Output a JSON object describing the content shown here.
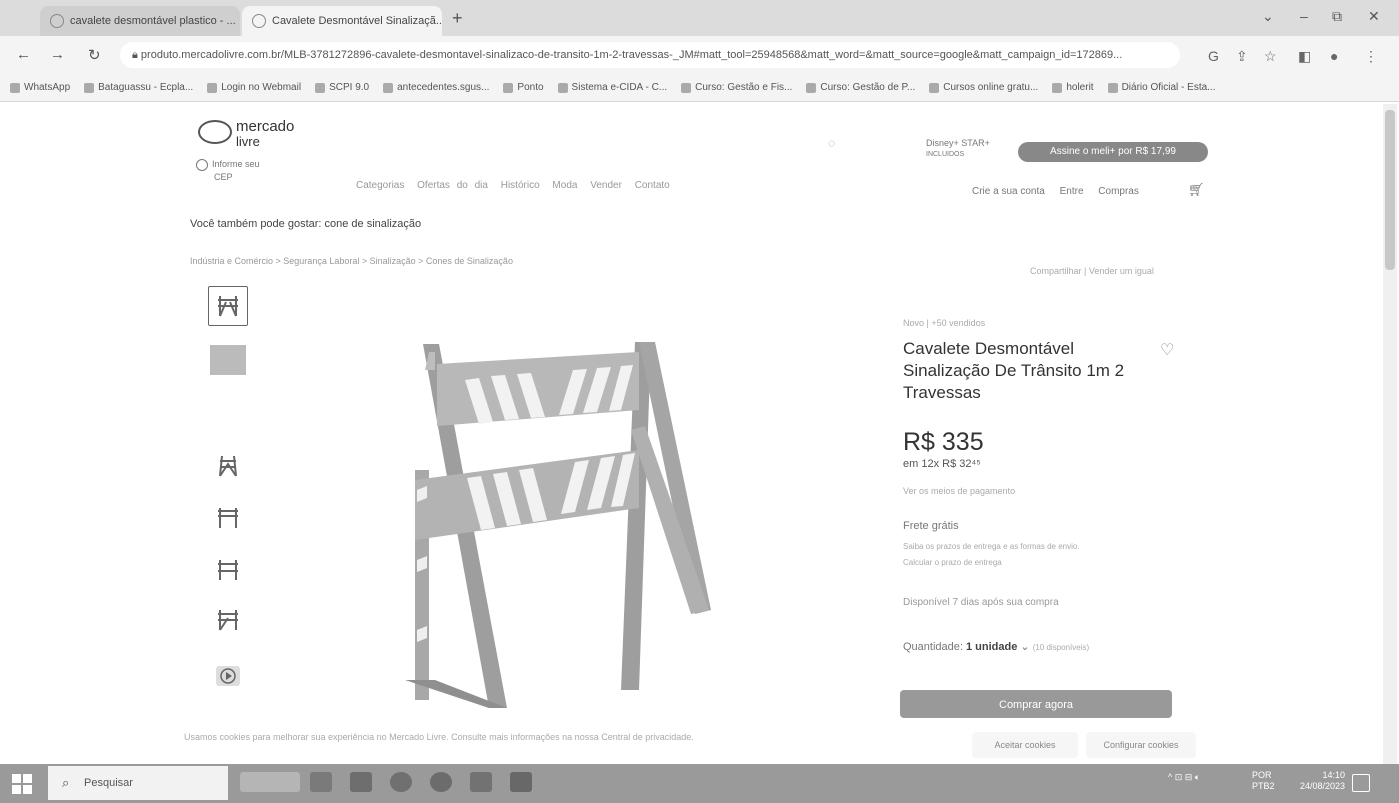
{
  "browser": {
    "tabs": [
      {
        "label": "cavalete desmontável plastico - ..."
      },
      {
        "label": "Cavalete Desmontável Sinalizaçã..."
      }
    ],
    "new_tab": "+",
    "url": "produto.mercadolivre.com.br/MLB-3781272896-cavalete-desmontavel-sinalizaco-de-transito-1m-2-travessas-_JM#matt_tool=25948568&matt_word=&matt_source=google&matt_campaign_id=172869...",
    "bookmarks": [
      "WhatsApp",
      "Bataguassu - Ecpla...",
      "Login no Webmail",
      "SCPI 9.0",
      "antecedentes.sgus...",
      "Ponto",
      "Sistema e-CIDA - C...",
      "Curso: Gestão e Fis...",
      "Curso: Gestão de P...",
      "Cursos online gratu...",
      "holerit",
      "Diário Oficial - Esta..."
    ],
    "window_controls": {
      "minimize": "–",
      "maximize": "⧉",
      "close": "✕",
      "dropdown": "⌄"
    }
  },
  "header": {
    "logo_line1": "mercado",
    "logo_line2": "livre",
    "cep_line1": "Informe seu",
    "cep_line2": "CEP",
    "disney_text": "Disney+ STAR+",
    "disney_sub": "INCLUIDOS",
    "meli_banner": "Assine o meli+ por R$ 17,99",
    "categories": [
      "Categorias",
      "Ofertas do dia",
      "Histórico",
      "Moda",
      "Vender",
      "Contato"
    ],
    "account": [
      "Crie a sua conta",
      "Entre",
      "Compras"
    ]
  },
  "suggestion": "Você também pode gostar: cone de sinalização",
  "breadcrumb": "Indústria e Comércio  >  Segurança Laboral  >  Sinalização  >  Cones de Sinalização",
  "share_text": "Compartilhar  |  Vender um igual",
  "product": {
    "condition": "Novo  |  +50 vendidos",
    "title": "Cavalete Desmontável Sinalização De Trânsito 1m 2 Travessas",
    "price": "R$ 335",
    "installments": "em 12x R$ 32⁴⁵",
    "payment_link": "Ver os meios de pagamento",
    "shipping_title": "Frete grátis",
    "shipping_line1": "Saiba os prazos de entrega e as formas de envio.",
    "shipping_line2": "Calcular o prazo de entrega",
    "availability": "Disponível 7 dias após sua compra",
    "quantity_label": "Quantidade:",
    "quantity_value": "1 unidade",
    "quantity_available": "(10 disponíveis)",
    "buy_button": "Comprar agora"
  },
  "cookie_bar": {
    "text": "Usamos cookies para melhorar sua experiência no Mercado Livre. Consulte mais informações na nossa Central de privacidade.",
    "accept": "Aceitar cookies",
    "configure": "Configurar cookies"
  },
  "taskbar": {
    "search_placeholder": "Pesquisar",
    "language_line1": "POR",
    "language_line2": "PTB2",
    "time": "14:10",
    "date": "24/08/2023"
  },
  "colors": {
    "banner_gray": "#888888",
    "buy_button": "#999999",
    "taskbar": "#9a9a9a"
  }
}
